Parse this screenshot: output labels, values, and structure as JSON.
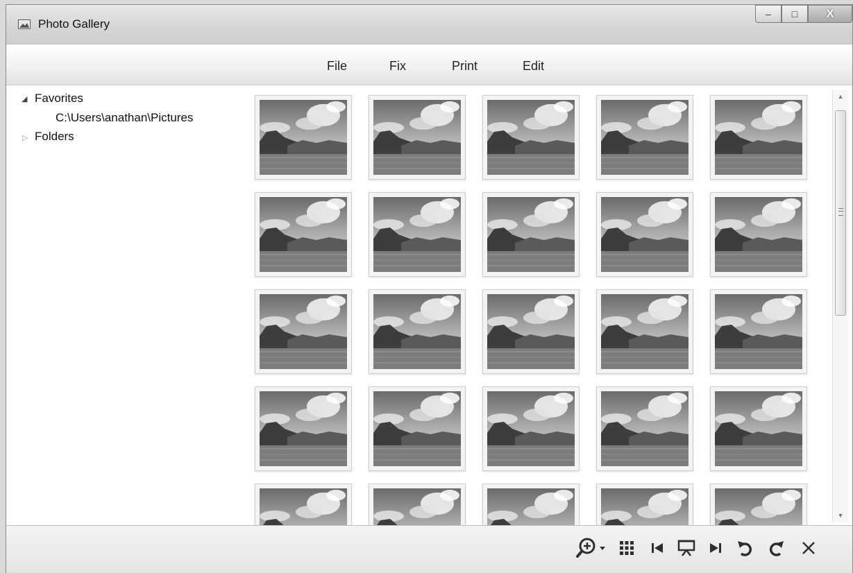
{
  "window": {
    "title": "Photo Gallery"
  },
  "window_controls": {
    "minimize_glyph": "–",
    "maximize_glyph": "□",
    "close_glyph": "X"
  },
  "menu": [
    {
      "label": "File"
    },
    {
      "label": "Fix"
    },
    {
      "label": "Print"
    },
    {
      "label": "Edit"
    }
  ],
  "tree": {
    "favorites": {
      "label": "Favorites",
      "expanded": true,
      "children": [
        "C:\\Users\\anathan\\Pictures"
      ]
    },
    "folders": {
      "label": "Folders",
      "expanded": false
    }
  },
  "gallery": {
    "columns": 5,
    "thumbnail_count": 25,
    "thumbnail_subject": "landscape-photo"
  },
  "toolbar": {
    "buttons": [
      {
        "name": "zoom-button",
        "icon": "zoom-in-icon"
      },
      {
        "name": "grid-view-button",
        "icon": "grid-icon"
      },
      {
        "name": "previous-button",
        "icon": "skip-back-icon"
      },
      {
        "name": "slideshow-button",
        "icon": "slideshow-icon"
      },
      {
        "name": "next-button",
        "icon": "skip-forward-icon"
      },
      {
        "name": "rotate-left-button",
        "icon": "rotate-ccw-icon"
      },
      {
        "name": "rotate-right-button",
        "icon": "rotate-cw-icon"
      },
      {
        "name": "delete-button",
        "icon": "close-icon"
      }
    ]
  },
  "colors": {
    "chrome": "#d9d9d9",
    "text": "#111111"
  }
}
